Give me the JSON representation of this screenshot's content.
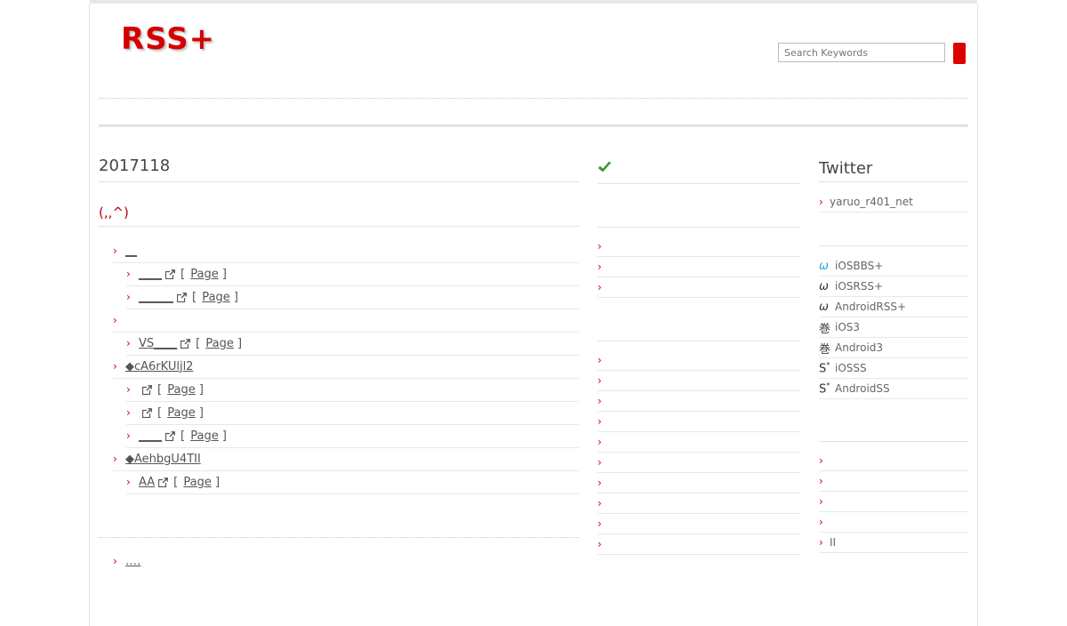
{
  "header": {
    "logo": "RSS+",
    "search_placeholder": "Search Keywords"
  },
  "main": {
    "title": "2017118",
    "subtitle": "(,,^)",
    "page_label": "Page",
    "rows": [
      {
        "level": 1,
        "text": "__",
        "has_ext": false,
        "has_page": false
      },
      {
        "level": 2,
        "text": "____",
        "has_ext": true,
        "has_page": true
      },
      {
        "level": 2,
        "text": "______",
        "has_ext": true,
        "has_page": true
      },
      {
        "level": 1,
        "text": "",
        "has_ext": false,
        "has_page": false
      },
      {
        "level": 2,
        "text": "VS____",
        "has_ext": true,
        "has_page": true
      },
      {
        "level": 1,
        "text": "◆cA6rKUljl2",
        "has_ext": false,
        "has_page": false
      },
      {
        "level": 2,
        "text": "",
        "has_ext": true,
        "has_page": true
      },
      {
        "level": 2,
        "text": "",
        "has_ext": true,
        "has_page": true
      },
      {
        "level": 2,
        "text": "____",
        "has_ext": true,
        "has_page": true
      },
      {
        "level": 1,
        "text": "◆AehbgU4TII",
        "has_ext": false,
        "has_page": false
      },
      {
        "level": 2,
        "text": "AA",
        "has_ext": true,
        "has_page": true
      }
    ],
    "next_row_text": "‥‥"
  },
  "middle": {
    "check_icon": "check-icon",
    "group1_count": 3,
    "group2_count": 10
  },
  "sidebar": {
    "twitter_title": "Twitter",
    "twitter_account": "yaruo_r401_net",
    "apps": [
      {
        "icon": "ω",
        "icon_name": "omega-icon",
        "icon_color": "#2aa0d8",
        "label": "iOSBBS+"
      },
      {
        "icon": "ω",
        "icon_name": "omega-icon",
        "icon_color": "#333333",
        "label": "iOSRSS+"
      },
      {
        "icon": "ω",
        "icon_name": "omega-icon",
        "icon_color": "#333333",
        "label": "AndroidRSS+"
      },
      {
        "icon": "巻",
        "icon_name": "scroll-kanji-icon",
        "icon_color": "#444444",
        "label": "iOS3"
      },
      {
        "icon": "巻",
        "icon_name": "scroll-kanji-icon",
        "icon_color": "#444444",
        "label": "Android3"
      },
      {
        "icon": "S*",
        "icon_name": "s-star-icon",
        "icon_color": "#333333",
        "label": "iOSSS"
      },
      {
        "icon": "S*",
        "icon_name": "s-star-icon",
        "icon_color": "#333333",
        "label": "AndroidSS"
      }
    ],
    "bottom_links": [
      "",
      "",
      "",
      "",
      "II"
    ]
  },
  "colors": {
    "accent": "#d40000",
    "check": "#3a9b2e"
  }
}
